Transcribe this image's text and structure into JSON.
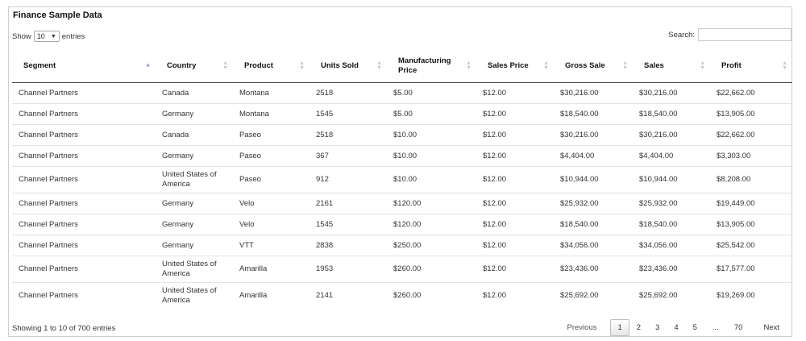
{
  "title": "Finance Sample Data",
  "length": {
    "show_label": "Show",
    "selected": "10",
    "entries_label": "entries"
  },
  "search": {
    "label": "Search:",
    "value": ""
  },
  "columns": [
    "Segment",
    "Country",
    "Product",
    "Units Sold",
    "Manufacturing Price",
    "Sales Price",
    "Gross Sale",
    "Sales",
    "Profit"
  ],
  "rows": [
    [
      "Channel Partners",
      "Canada",
      "Montana",
      "2518",
      "$5.00",
      "$12.00",
      "$30,216.00",
      "$30,216.00",
      "$22,662.00"
    ],
    [
      "Channel Partners",
      "Germany",
      "Montana",
      "1545",
      "$5.00",
      "$12.00",
      "$18,540.00",
      "$18,540.00",
      "$13,905.00"
    ],
    [
      "Channel Partners",
      "Canada",
      "Paseo",
      "2518",
      "$10.00",
      "$12.00",
      "$30,216.00",
      "$30,216.00",
      "$22,662.00"
    ],
    [
      "Channel Partners",
      "Germany",
      "Paseo",
      "367",
      "$10.00",
      "$12.00",
      "$4,404.00",
      "$4,404.00",
      "$3,303.00"
    ],
    [
      "Channel Partners",
      "United States of America",
      "Paseo",
      "912",
      "$10.00",
      "$12.00",
      "$10,944.00",
      "$10,944.00",
      "$8,208.00"
    ],
    [
      "Channel Partners",
      "Germany",
      "Velo",
      "2161",
      "$120.00",
      "$12.00",
      "$25,932.00",
      "$25,932.00",
      "$19,449.00"
    ],
    [
      "Channel Partners",
      "Germany",
      "Velo",
      "1545",
      "$120.00",
      "$12.00",
      "$18,540.00",
      "$18,540.00",
      "$13,905.00"
    ],
    [
      "Channel Partners",
      "Germany",
      "VTT",
      "2838",
      "$250.00",
      "$12.00",
      "$34,056.00",
      "$34,056.00",
      "$25,542.00"
    ],
    [
      "Channel Partners",
      "United States of America",
      "Amarilla",
      "1953",
      "$260.00",
      "$12.00",
      "$23,436.00",
      "$23,436.00",
      "$17,577.00"
    ],
    [
      "Channel Partners",
      "United States of America",
      "Amarilla",
      "2141",
      "$260.00",
      "$12.00",
      "$25,692.00",
      "$25,692.00",
      "$19,269.00"
    ]
  ],
  "info": "Showing 1 to 10 of 700 entries",
  "pager": {
    "previous": "Previous",
    "pages": [
      "1",
      "2",
      "3",
      "4",
      "5",
      "...",
      "70"
    ],
    "current": "1",
    "next": "Next"
  }
}
